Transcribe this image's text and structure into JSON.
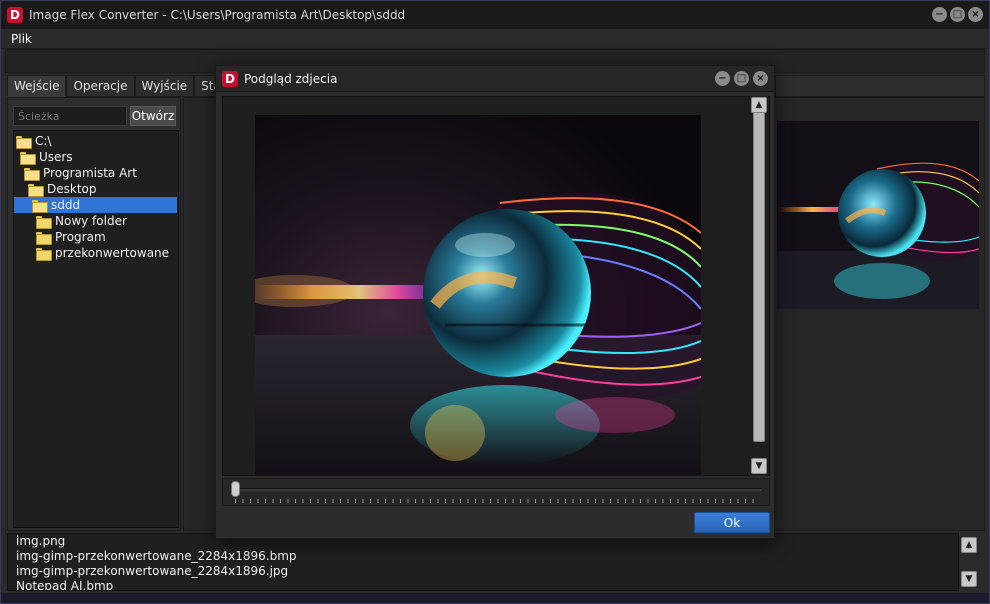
{
  "app": {
    "title": "Image Flex Converter - C:\\Users\\Programista Art\\Desktop\\sddd",
    "icon_letter": "D",
    "accent": "#c8102e"
  },
  "menu": {
    "file": "Plik"
  },
  "tabs": [
    {
      "label": "Wejście",
      "active": true
    },
    {
      "label": "Operacje"
    },
    {
      "label": "Wyjście"
    },
    {
      "label": "Stan"
    }
  ],
  "path": {
    "placeholder": "Ścieżka",
    "open_label": "Otwórz"
  },
  "tree": [
    {
      "label": "C:\\",
      "level": 0,
      "icon": "folder-open-icon"
    },
    {
      "label": "Users",
      "level": 1,
      "icon": "folder-open-icon"
    },
    {
      "label": "Programista Art",
      "level": 2,
      "icon": "folder-open-icon"
    },
    {
      "label": "Desktop",
      "level": 3,
      "icon": "folder-open-icon"
    },
    {
      "label": "sddd",
      "level": 4,
      "icon": "folder-open-icon",
      "selected": true
    },
    {
      "label": "Nowy folder",
      "level": 5,
      "icon": "folder-icon"
    },
    {
      "label": "Program",
      "level": 5,
      "icon": "folder-icon"
    },
    {
      "label": "przekonwertowane",
      "level": 5,
      "icon": "folder-icon"
    }
  ],
  "files": [
    "img.png",
    "img-gimp-przekonwertowane_2284x1896.bmp",
    "img-gimp-przekonwertowane_2284x1896.jpg",
    "Notepad AI.bmp"
  ],
  "dialog": {
    "title": "Podgląd zdjecia",
    "ok_label": "Ok",
    "zoom_slider_value": 0,
    "vertical_scroll_value": 0
  },
  "colors": {
    "selection": "#2f73d6",
    "ok_button": "#2f6fc4"
  }
}
